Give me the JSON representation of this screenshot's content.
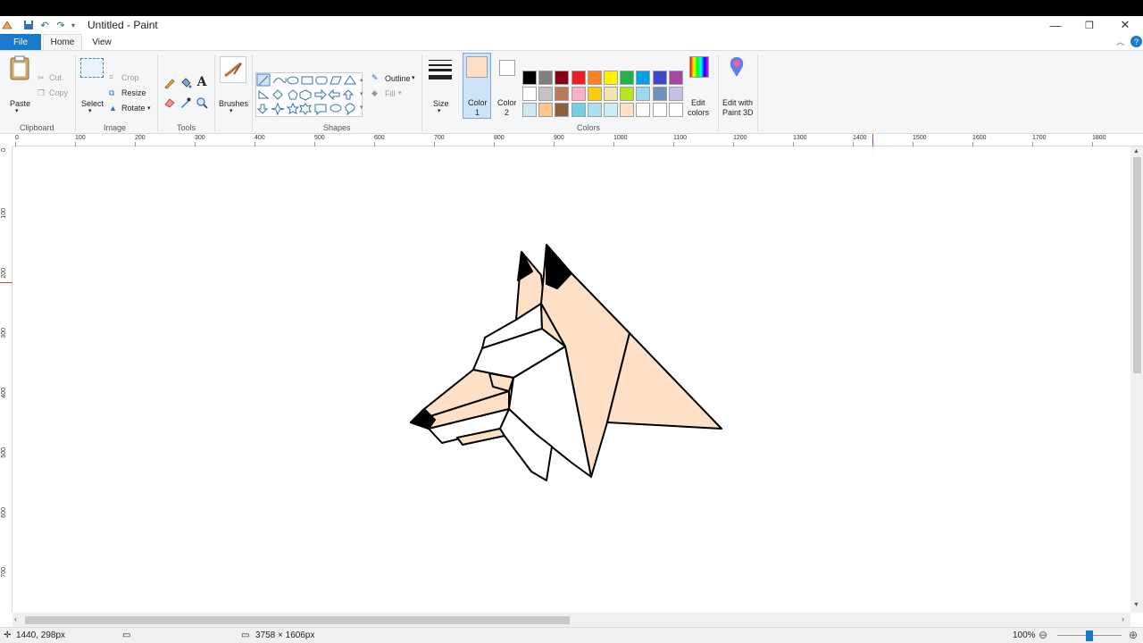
{
  "window": {
    "title": "Untitled - Paint"
  },
  "tabs": {
    "file": "File",
    "home": "Home",
    "view": "View"
  },
  "clipboard": {
    "paste": "Paste",
    "cut": "Cut",
    "copy": "Copy",
    "label": "Clipboard"
  },
  "image": {
    "select": "Select",
    "crop": "Crop",
    "resize": "Resize",
    "rotate": "Rotate",
    "label": "Image"
  },
  "tools": {
    "label": "Tools",
    "text_glyph": "A"
  },
  "brushes": {
    "label": "Brushes"
  },
  "shapes": {
    "outline": "Outline",
    "fill": "Fill",
    "label": "Shapes"
  },
  "size": {
    "label": "Size"
  },
  "color1": {
    "label1": "Color",
    "label2": "1",
    "value": "#fde0c6"
  },
  "color2": {
    "label1": "Color",
    "label2": "2",
    "value": "#ffffff"
  },
  "colors": {
    "label": "Colors",
    "row1": [
      "#000000",
      "#7f7f7f",
      "#880015",
      "#ed1c24",
      "#ff7f27",
      "#fff200",
      "#22b14c",
      "#00a2e8",
      "#3f48cc",
      "#a349a4"
    ],
    "row2": [
      "#ffffff",
      "#c3c3c3",
      "#b97a57",
      "#ffaec9",
      "#ffc90e",
      "#efe4b0",
      "#b5e61d",
      "#99d9ea",
      "#7092be",
      "#c8bfe7"
    ],
    "row3": [
      "#cfe7f1",
      "#fcc68c",
      "#8b5e3c",
      "#72cfe1",
      "#a9e0ed",
      "#c8edf3",
      "#fde0c6",
      "#ffffff",
      "#ffffff",
      "#ffffff"
    ],
    "edit_label1": "Edit",
    "edit_label2": "colors",
    "paint3d_label1": "Edit with",
    "paint3d_label2": "Paint 3D"
  },
  "ruler": {
    "h_labels": [
      "0",
      "100",
      "200",
      "300",
      "400",
      "500",
      "600",
      "700",
      "800",
      "900",
      "1000",
      "1100",
      "1200",
      "1300",
      "1400",
      "1500",
      "1600",
      "1700",
      "1800"
    ],
    "v_labels": [
      "0",
      "100",
      "200",
      "300",
      "400",
      "500",
      "600",
      "700"
    ]
  },
  "status": {
    "cursor": "1440, 298px",
    "dimensions": "3758 × 1606px",
    "zoom": "100%"
  },
  "icons": [
    "paint-app-icon",
    "save-icon",
    "undo-icon",
    "redo-icon",
    "help-icon",
    "minimize-icon",
    "maximize-icon",
    "close-icon"
  ]
}
